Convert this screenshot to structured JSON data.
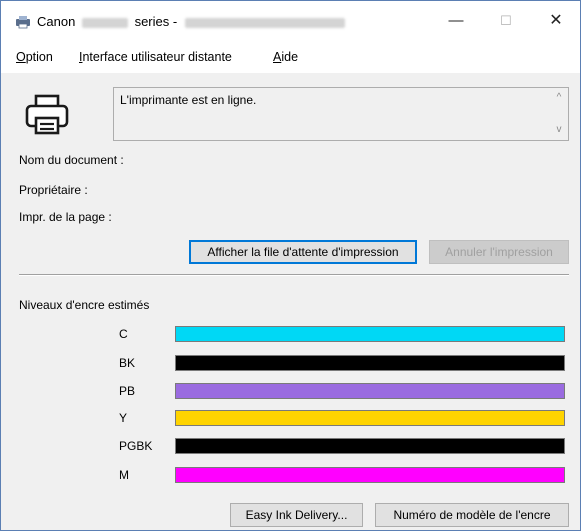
{
  "window": {
    "title_prefix": "Canon",
    "title_middle": "series -",
    "minimize_glyph": "—",
    "maximize_glyph": "☐",
    "close_glyph": "✕"
  },
  "menu": {
    "items": [
      {
        "label_first": "O",
        "label_rest": "ption"
      },
      {
        "label_first": "I",
        "label_rest": "nterface utilisateur distante"
      },
      {
        "label_first": "A",
        "label_rest": "ide"
      }
    ]
  },
  "status": {
    "message": "L'imprimante est en ligne."
  },
  "info": {
    "document_label": "Nom du document :",
    "owner_label": "Propriétaire :",
    "page_label": "Impr. de la page :"
  },
  "buttons": {
    "show_queue": "Afficher la file d'attente d'impression",
    "cancel_print": "Annuler l'impression",
    "easy_ink": "Easy Ink Delivery...",
    "ink_model": "Numéro de modèle de l'encre"
  },
  "ink": {
    "heading": "Niveaux d'encre estimés",
    "levels": [
      {
        "name": "C",
        "color": "#00d8f5",
        "level": 1.0
      },
      {
        "name": "BK",
        "color": "#000000",
        "level": 1.0
      },
      {
        "name": "PB",
        "color": "#9a6be0",
        "level": 1.0
      },
      {
        "name": "Y",
        "color": "#ffd400",
        "level": 1.0
      },
      {
        "name": "PGBK",
        "color": "#000000",
        "level": 1.0
      },
      {
        "name": "M",
        "color": "#ff00ff",
        "level": 1.0
      }
    ]
  }
}
